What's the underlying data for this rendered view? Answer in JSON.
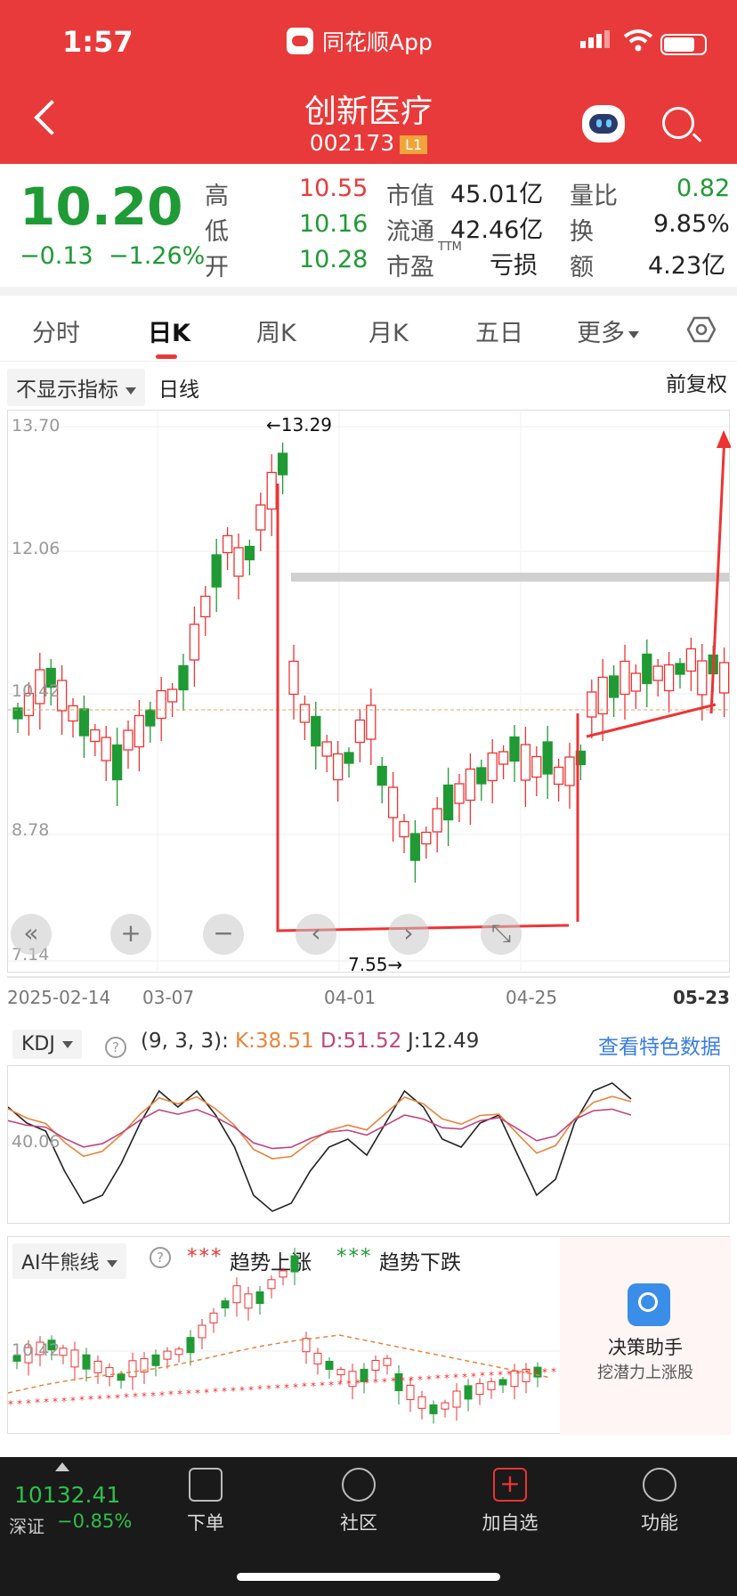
{
  "status_bar": {
    "time": "1:57",
    "app_name": "同花顺App"
  },
  "header": {
    "stock_name": "创新医疗",
    "stock_code": "002173",
    "level_badge": "L1"
  },
  "quote": {
    "price": "10.20",
    "change": "−0.13",
    "change_pct": "−1.26%",
    "high_label": "高",
    "high": "10.55",
    "low_label": "低",
    "low": "10.16",
    "open_label": "开",
    "open": "10.28",
    "mcap_label": "市值",
    "mcap": "45.01亿",
    "float_label": "流通",
    "float": "42.46亿",
    "pe_label": "市盈",
    "pe_sup": "TTM",
    "pe": "亏损",
    "vr_label": "量比",
    "vr": "0.82",
    "turn_label": "换",
    "turn": "9.85%",
    "amt_label": "额",
    "amt": "4.23亿",
    "colors": {
      "up": "#e83a3a",
      "down": "#1f9a35"
    }
  },
  "tabs": [
    {
      "label": "分时"
    },
    {
      "label": "日K"
    },
    {
      "label": "周K"
    },
    {
      "label": "月K"
    },
    {
      "label": "五日"
    },
    {
      "label": "更多"
    }
  ],
  "indicator_bar": {
    "selector": "不显示指标",
    "period": "日线",
    "adjust": "前复权"
  },
  "kline": {
    "y_ticks": [
      "13.70",
      "12.06",
      "10.42",
      "8.78",
      "7.14"
    ],
    "high_marker": "←13.29",
    "low_marker": "7.55→",
    "dates": [
      "2025-02-14",
      "03-07",
      "04-01",
      "04-25",
      "05-23"
    ],
    "controls": [
      "«",
      "+",
      "−",
      "‹",
      "›",
      "⤡"
    ]
  },
  "kdj": {
    "selector": "KDJ",
    "params": "(9, 3, 3):",
    "k": "K:38.51",
    "d": "D:51.52",
    "j": "J:12.49",
    "link": "查看特色数据",
    "y_tick": "40.06"
  },
  "ai": {
    "selector": "AI牛熊线",
    "up_legend": "趋势上涨",
    "down_legend": "趋势下跌",
    "y_tick": "10.42",
    "assistant_title": "决策助手",
    "assistant_sub": "挖潜力上涨股"
  },
  "bottom_nav": {
    "index_value": "10132.41",
    "index_name": "深证",
    "index_change": "−0.85%",
    "items": [
      {
        "label": "下单"
      },
      {
        "label": "社区"
      },
      {
        "label": "加自选"
      },
      {
        "label": "功能"
      }
    ]
  }
}
